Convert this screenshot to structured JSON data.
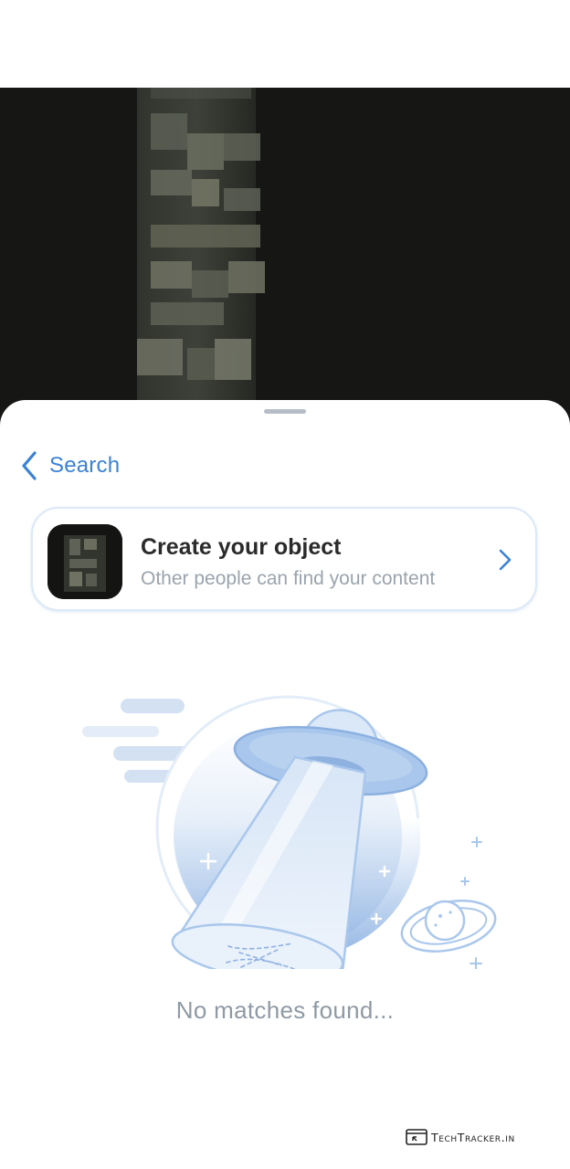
{
  "header": {
    "back_label": "Search"
  },
  "create_card": {
    "title": "Create your object",
    "subtitle": "Other people can find your content"
  },
  "empty_state": {
    "message": "No matches found..."
  },
  "watermark": {
    "text": "TechTracker.in"
  },
  "colors": {
    "accent": "#3a82d6",
    "card_border": "#dde9f7",
    "muted_text": "#8f9aa4",
    "illustration_blue": "#a9c7ec"
  },
  "icons": {
    "back": "chevron-left-icon",
    "card_next": "chevron-right-icon",
    "illustration": "ufo-illustration",
    "watermark": "browser-window-icon"
  }
}
